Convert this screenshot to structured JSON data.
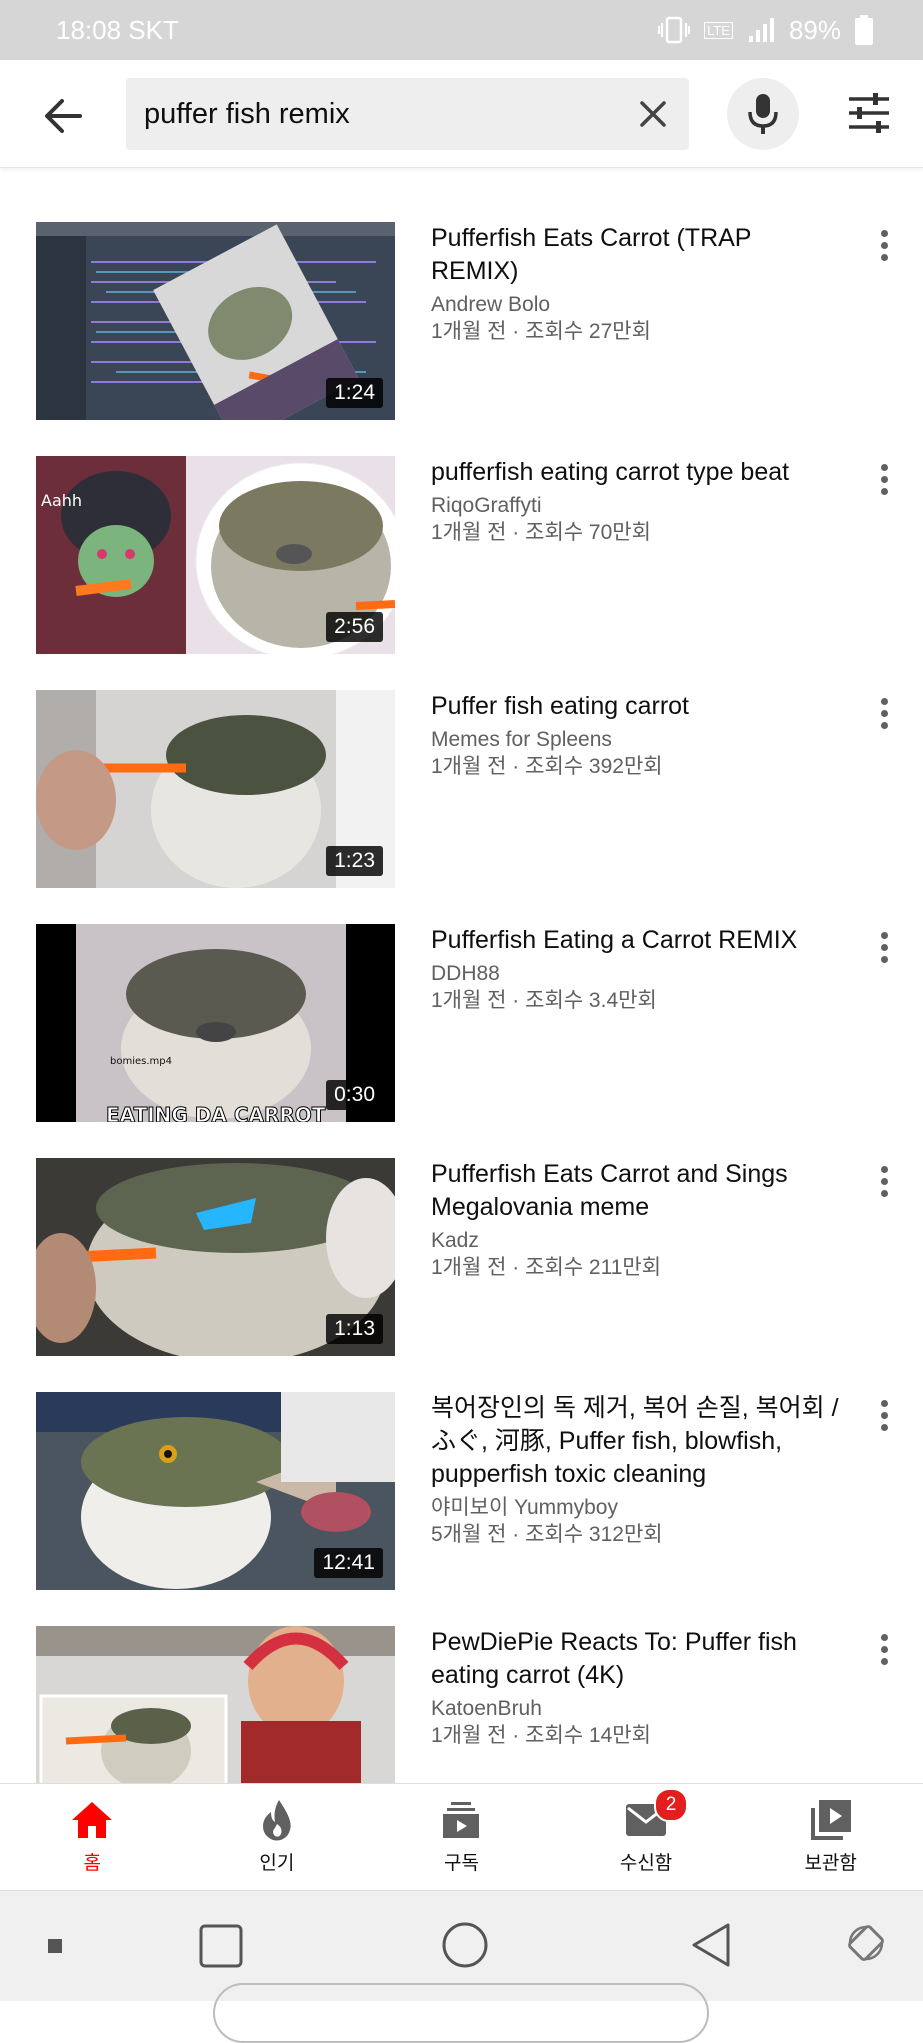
{
  "status_bar": {
    "time": "18:08 SKT",
    "battery": "89%",
    "network": "LTE"
  },
  "search": {
    "query": "puffer fish remix"
  },
  "icons": {
    "back": "arrow-left-icon",
    "clear": "close-icon",
    "mic": "mic-icon",
    "filter": "sliders-icon",
    "more": "more-vert-icon"
  },
  "results": [
    {
      "title": "Pufferfish Eats Carrot (TRAP REMIX)",
      "channel": "Andrew Bolo",
      "stats": "1개월 전 · 조회수 27만회",
      "duration": "1:24"
    },
    {
      "title": "pufferfish eating carrot type beat",
      "channel": "RiqoGraffyti",
      "stats": "1개월 전 · 조회수 70만회",
      "duration": "2:56"
    },
    {
      "title": "Puffer fish eating carrot",
      "channel": "Memes for Spleens",
      "stats": "1개월 전 · 조회수 392만회",
      "duration": "1:23"
    },
    {
      "title": "Pufferfish Eating a Carrot REMIX",
      "channel": "DDH88",
      "stats": "1개월 전 · 조회수 3.4만회",
      "duration": "0:30",
      "thumb_text_1": "bomies.mp4",
      "thumb_text_2": "EATING DA CARROT"
    },
    {
      "title": "Pufferfish Eats Carrot and Sings Megalovania meme",
      "channel": "Kadz",
      "stats": "1개월 전 · 조회수 211만회",
      "duration": "1:13"
    },
    {
      "title": "복어장인의 독 제거, 복어 손질, 복어회 / ふぐ, 河豚, Puffer fish, blowfish, pupperfish toxic cleaning",
      "channel": "야미보이 Yummyboy",
      "stats": "5개월 전 · 조회수 312만회",
      "duration": "12:41"
    },
    {
      "title": "PewDiePie Reacts To: Puffer fish eating carrot (4K)",
      "channel": "KatoenBruh",
      "stats": "1개월 전 · 조회수 14만회",
      "duration": ""
    }
  ],
  "bottom_nav": [
    {
      "label": "홈",
      "icon": "home-icon",
      "active": true
    },
    {
      "label": "인기",
      "icon": "flame-icon"
    },
    {
      "label": "구독",
      "icon": "subscriptions-icon"
    },
    {
      "label": "수신함",
      "icon": "inbox-icon",
      "badge": "2"
    },
    {
      "label": "보관함",
      "icon": "library-icon"
    }
  ],
  "colors": {
    "accent": "#ff0000",
    "badge": "#e41e1e",
    "status_bar": "#d6d6d6"
  }
}
